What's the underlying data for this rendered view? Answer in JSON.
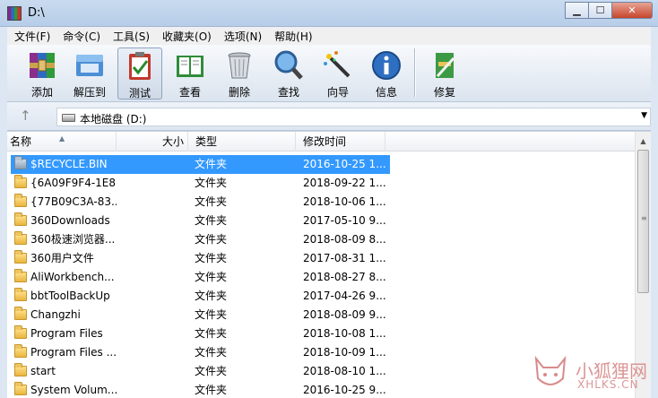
{
  "window": {
    "title": "D:\\"
  },
  "menu": [
    "文件(F)",
    "命令(C)",
    "工具(S)",
    "收藏夹(O)",
    "选项(N)",
    "帮助(H)"
  ],
  "toolbar": {
    "buttons": [
      {
        "label": "添加",
        "icon": "add-archive-icon"
      },
      {
        "label": "解压到",
        "icon": "extract-folder-icon"
      },
      {
        "label": "测试",
        "icon": "test-clipboard-icon",
        "active": true
      },
      {
        "label": "查看",
        "icon": "view-book-icon"
      },
      {
        "label": "删除",
        "icon": "trash-icon"
      },
      {
        "label": "查找",
        "icon": "find-magnifier-icon"
      },
      {
        "label": "向导",
        "icon": "wizard-wand-icon"
      },
      {
        "label": "信息",
        "icon": "info-icon"
      },
      {
        "label": "修复",
        "icon": "repair-icon"
      }
    ]
  },
  "address": {
    "text": "本地磁盘 (D:)"
  },
  "columns": {
    "name": "名称",
    "size": "大小",
    "type": "类型",
    "modified": "修改时间"
  },
  "files": [
    {
      "name": "$RECYCLE.BIN",
      "type": "文件夹",
      "modified": "2016-10-25 1...",
      "selected": true,
      "recycle": true
    },
    {
      "name": "{6A09F9F4-1E8...",
      "type": "文件夹",
      "modified": "2018-09-22 1..."
    },
    {
      "name": "{77B09C3A-83...",
      "type": "文件夹",
      "modified": "2018-10-06 1..."
    },
    {
      "name": "360Downloads",
      "type": "文件夹",
      "modified": "2017-05-10 9..."
    },
    {
      "name": "360极速浏览器...",
      "type": "文件夹",
      "modified": "2018-08-09 8..."
    },
    {
      "name": "360用户文件",
      "type": "文件夹",
      "modified": "2017-08-31 1..."
    },
    {
      "name": "AliWorkbench...",
      "type": "文件夹",
      "modified": "2018-08-27 8..."
    },
    {
      "name": "bbtToolBackUp",
      "type": "文件夹",
      "modified": "2017-04-26 9..."
    },
    {
      "name": "Changzhi",
      "type": "文件夹",
      "modified": "2018-08-09 9..."
    },
    {
      "name": "Program Files",
      "type": "文件夹",
      "modified": "2018-10-08 1..."
    },
    {
      "name": "Program Files ...",
      "type": "文件夹",
      "modified": "2018-10-09 1..."
    },
    {
      "name": "start",
      "type": "文件夹",
      "modified": "2018-08-10 1..."
    },
    {
      "name": "System Volum...",
      "type": "文件夹",
      "modified": "2016-10-25 9..."
    }
  ],
  "watermark": {
    "text": "小狐狸网",
    "url": "XHLKS.CN"
  }
}
